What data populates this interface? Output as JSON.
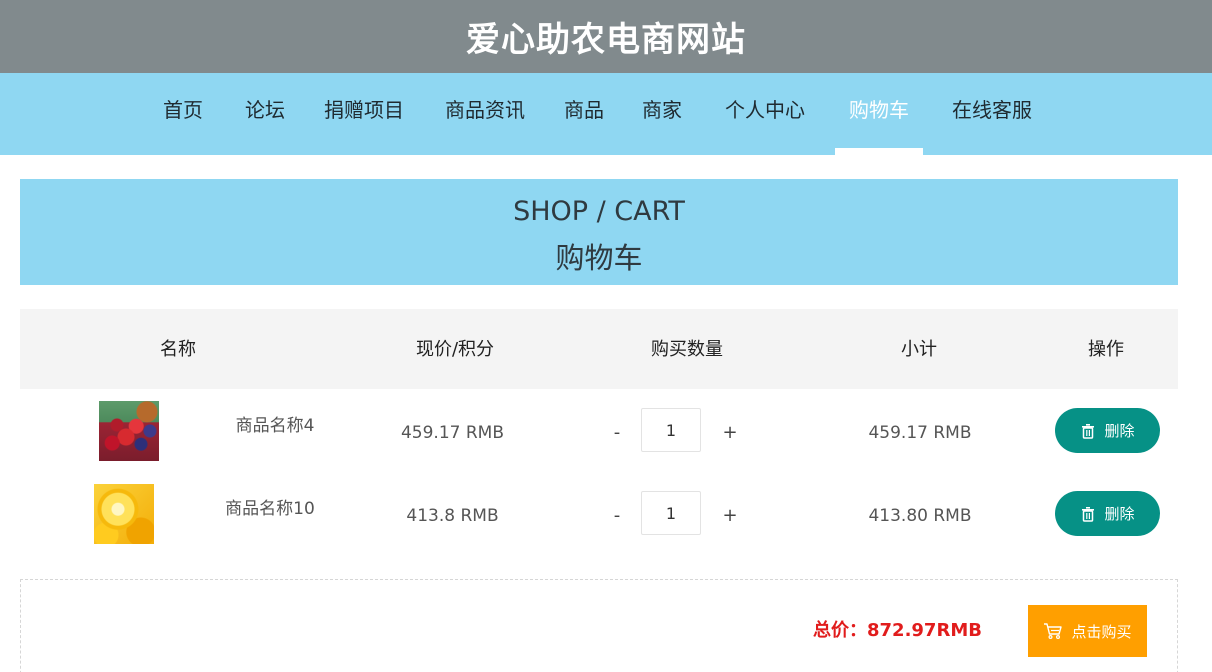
{
  "site": {
    "title": "爱心助农电商网站"
  },
  "nav": {
    "items": [
      {
        "label": "首页"
      },
      {
        "label": "论坛"
      },
      {
        "label": "捐赠项目"
      },
      {
        "label": "商品资讯"
      },
      {
        "label": "商品"
      },
      {
        "label": "商家"
      },
      {
        "label": "个人中心"
      },
      {
        "label": "购物车",
        "active": true
      },
      {
        "label": "在线客服"
      }
    ]
  },
  "banner": {
    "title_en": "SHOP / CART",
    "title_cn": "购物车"
  },
  "cart": {
    "headers": {
      "name": "名称",
      "price": "现价/积分",
      "quantity": "购买数量",
      "subtotal": "小计",
      "action": "操作"
    },
    "items": [
      {
        "image_icon": "berries-thumbnail",
        "name": "商品名称4",
        "price": "459.17 RMB",
        "quantity": "1",
        "subtotal": "459.17 RMB",
        "minus": "-",
        "plus": "+",
        "delete_label": "删除"
      },
      {
        "image_icon": "lemon-thumbnail",
        "name": "商品名称10",
        "price": "413.8 RMB",
        "quantity": "1",
        "subtotal": "413.80 RMB",
        "minus": "-",
        "plus": "+",
        "delete_label": "删除"
      }
    ],
    "total_label": "总价：872.97RMB",
    "buy_label": "点击购买"
  },
  "colors": {
    "header_bg": "#818a8d",
    "nav_bg": "#8fd7f2",
    "delete_button": "#069186",
    "buy_button": "#ff9f00",
    "total_text": "#e11c1c"
  }
}
